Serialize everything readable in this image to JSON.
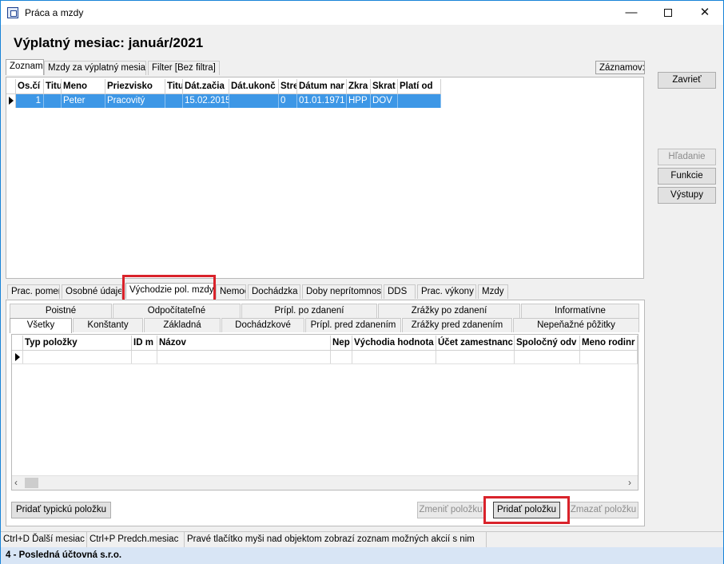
{
  "window": {
    "title": "Práca a mzdy"
  },
  "page": {
    "title": "Výplatný mesiac: január/2021"
  },
  "top_tabs": [
    {
      "label": "Zoznam",
      "active": true
    },
    {
      "label": "Mzdy za výplatný mesiac",
      "active": false
    },
    {
      "label": "Filter [Bez filtra]",
      "active": false
    }
  ],
  "records_label": "Záznamov:",
  "side_buttons": {
    "close": "Zavrieť",
    "search": "Hľadanie",
    "functions": "Funkcie",
    "outputs": "Výstupy"
  },
  "employee_table": {
    "columns": [
      "Os.čí",
      "Titu",
      "Meno",
      "Priezvisko",
      "Titu",
      "Dát.začia",
      "Dát.ukonč",
      "Stre",
      "Dátum nar",
      "Zkra",
      "Skrat",
      "Platí od"
    ],
    "rows": [
      [
        "1",
        "",
        "Peter",
        "Pracovitý",
        "",
        "15.02.2015",
        "",
        "0",
        "01.01.1971",
        "HPP",
        "DOV",
        ""
      ]
    ]
  },
  "detail_tabs": [
    {
      "label": "Prac. pomer"
    },
    {
      "label": "Osobné údaje"
    },
    {
      "label": "Východzie pol. mzdy",
      "active": true
    },
    {
      "label": "Nemoc"
    },
    {
      "label": "Dochádzka"
    },
    {
      "label": "Doby neprítomnosti"
    },
    {
      "label": "DDS"
    },
    {
      "label": "Prac. výkony"
    },
    {
      "label": "Mzdy"
    }
  ],
  "category_tabs_row1": [
    "Poistné",
    "Odpočítateľné",
    "Prípl. po zdanení",
    "Zrážky po zdanení",
    "Informatívne"
  ],
  "category_tabs_row2": [
    "Všetky",
    "Konštanty",
    "Základná",
    "Dochádzkové",
    "Prípl. pred zdanením",
    "Zrážky pred zdanením",
    "Nepeňažné pôžitky"
  ],
  "items_table": {
    "columns": [
      "Typ položky",
      "ID m",
      "Názov",
      "Nep",
      "Východia hodnota",
      "Účet zamestnanc",
      "Spoločný odv",
      "Meno rodinr"
    ]
  },
  "bottom_buttons": {
    "add_typical": "Pridať typickú položku",
    "change": "Zmeniť položku",
    "add": "Pridať položku",
    "delete": "Zmazať položku"
  },
  "status": {
    "next_month": "Ctrl+D Ďalší mesiac",
    "prev_month": "Ctrl+P Predch.mesiac",
    "hint": "Pravé tlačítko myši nad objektom zobrazí zoznam možných akcií s nim"
  },
  "company": "4 - Posledná účtovná s.r.o.",
  "colors": {
    "selection": "#3d97e6",
    "highlight": "#d9232b",
    "company_bar": "#d8e5f5"
  }
}
